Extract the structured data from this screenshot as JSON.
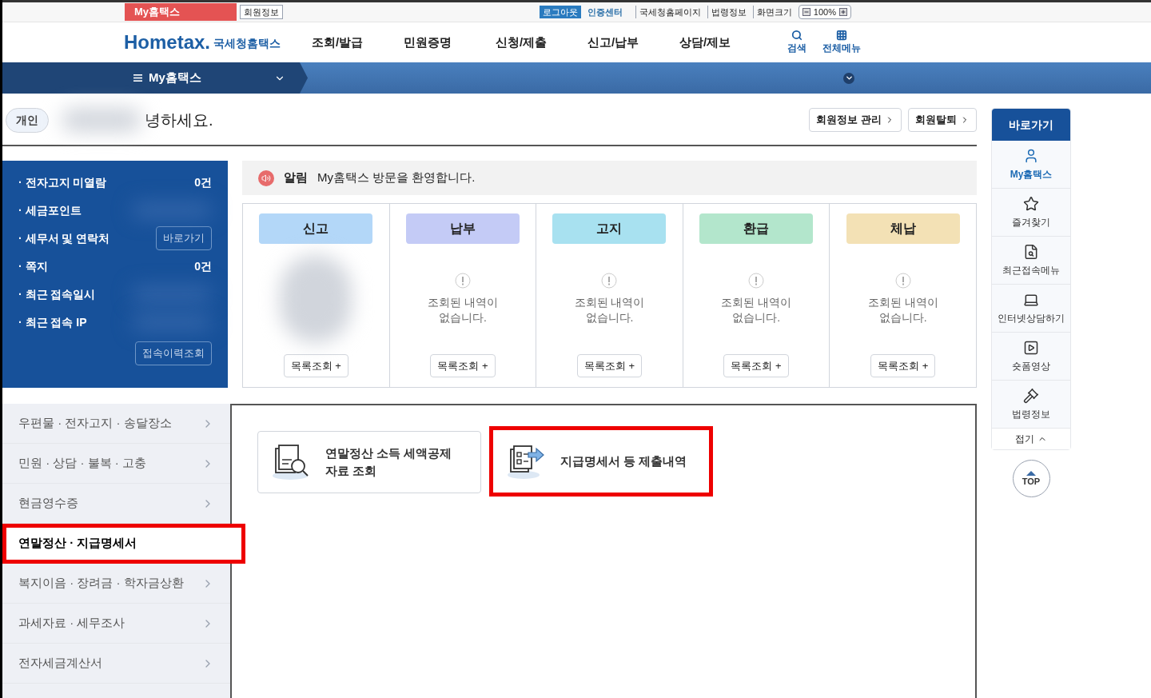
{
  "utility_bar": {
    "tabs": [
      {
        "label": "My홈택스",
        "selected": true
      },
      {
        "label": "회원정보",
        "selected": false
      }
    ],
    "logout": "로그아웃",
    "cert": "인증센터",
    "links": [
      "국세청홈페이지",
      "법령정보"
    ],
    "zoom_label": "화면크기",
    "zoom_value": "100%"
  },
  "header": {
    "logo_text": "Hometax.",
    "logo_sub": "국세청홈택스",
    "nav": [
      "조회/발급",
      "민원증명",
      "신청/제출",
      "신고/납부",
      "상담/제보"
    ],
    "tools": [
      {
        "label": "검색",
        "kind": "search"
      },
      {
        "label": "전체메뉴",
        "kind": "grid"
      }
    ]
  },
  "menu_bar": {
    "current": "My홈택스"
  },
  "greeting": {
    "badge": "개인",
    "text": "녕하세요.",
    "buttons": [
      "회원정보 관리",
      "회원탈퇴"
    ]
  },
  "summary": [
    {
      "label": "· 전자고지 미열람",
      "kind": "count",
      "value": "0건"
    },
    {
      "label": "· 세금포인트",
      "kind": "blurred"
    },
    {
      "label": "· 세무서 및 연락처",
      "kind": "button",
      "value": "바로가기"
    },
    {
      "label": "· 쪽지",
      "kind": "count",
      "value": "0건"
    },
    {
      "label": "· 최근 접속일시",
      "kind": "blurred"
    },
    {
      "label": "· 최근 접속 IP",
      "kind": "blurred"
    }
  ],
  "history_button": "접속이력조회",
  "notice": {
    "label": "알림",
    "text": "My홈택스 방문을 환영합니다."
  },
  "status": [
    {
      "title": "신고",
      "color": "#b3d7f8",
      "kind": "blurred",
      "button": "목록조회 +"
    },
    {
      "title": "납부",
      "color": "#c4cbf6",
      "kind": "empty",
      "lines": [
        "조회된 내역이",
        "없습니다."
      ],
      "button": "목록조회 +"
    },
    {
      "title": "고지",
      "color": "#a8e1f0",
      "kind": "empty",
      "lines": [
        "조회된 내역이",
        "없습니다."
      ],
      "button": "목록조회 +"
    },
    {
      "title": "환급",
      "color": "#b3e6cc",
      "kind": "empty",
      "lines": [
        "조회된 내역이",
        "없습니다."
      ],
      "button": "목록조회 +"
    },
    {
      "title": "체납",
      "color": "#f3e1b5",
      "kind": "empty",
      "lines": [
        "조회된 내역이",
        "없습니다."
      ],
      "button": "목록조회 +"
    }
  ],
  "side_menu": [
    {
      "label": "우편물 · 전자고지 · 송달장소",
      "selected": false,
      "highlighted": false
    },
    {
      "label": "민원 · 상담 · 불복 · 고충",
      "selected": false,
      "highlighted": false
    },
    {
      "label": "현금영수증",
      "selected": false,
      "highlighted": false
    },
    {
      "label": "연말정산 · 지급명세서",
      "selected": true,
      "highlighted": true
    },
    {
      "label": "복지이음 · 장려금 · 학자금상환",
      "selected": false,
      "highlighted": false
    },
    {
      "label": "과세자료 · 세무조사",
      "selected": false,
      "highlighted": false
    },
    {
      "label": "전자세금계산서",
      "selected": false,
      "highlighted": false
    }
  ],
  "shortcuts": [
    {
      "label": "연말정산 소득 세액공제\n자료 조회",
      "kind": "search-doc",
      "highlighted": false
    },
    {
      "label": "지급명세서 등 제출내역",
      "kind": "send-doc",
      "highlighted": true
    }
  ],
  "quick_menu": {
    "title": "바로가기",
    "items": [
      {
        "label": "My홈택스",
        "kind": "user",
        "selected": true
      },
      {
        "label": "즐겨찾기",
        "kind": "star",
        "selected": false
      },
      {
        "label": "최근접속메뉴",
        "kind": "recent",
        "selected": false
      },
      {
        "label": "인터넷상담하기",
        "kind": "laptop",
        "selected": false
      },
      {
        "label": "숏폼영상",
        "kind": "play",
        "selected": false
      },
      {
        "label": "법령정보",
        "kind": "gavel",
        "selected": false
      }
    ],
    "collapse": "접기",
    "top": "TOP"
  }
}
